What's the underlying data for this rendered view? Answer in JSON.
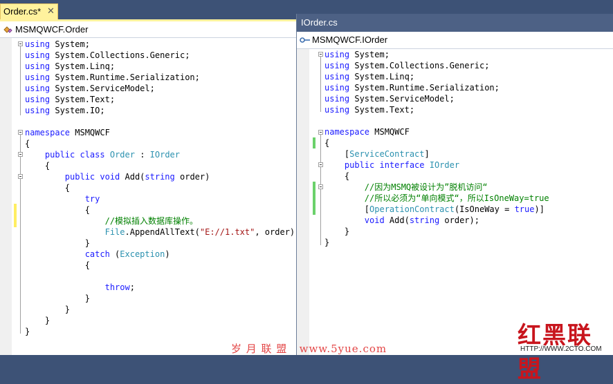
{
  "left_tab": {
    "title": "Order.cs*",
    "close_glyph": "✕"
  },
  "left_nav": {
    "label": "MSMQWCF.Order",
    "icon": "class-icon"
  },
  "right_window": {
    "title": "IOrder.cs"
  },
  "right_nav": {
    "label": "MSMQWCF.IOrder",
    "icon": "interface-icon"
  },
  "left_code": [
    [
      [
        "kw",
        "using"
      ],
      [
        "tx",
        " System;"
      ]
    ],
    [
      [
        "kw",
        "using"
      ],
      [
        "tx",
        " System.Collections.Generic;"
      ]
    ],
    [
      [
        "kw",
        "using"
      ],
      [
        "tx",
        " System.Linq;"
      ]
    ],
    [
      [
        "kw",
        "using"
      ],
      [
        "tx",
        " System.Runtime.Serialization;"
      ]
    ],
    [
      [
        "kw",
        "using"
      ],
      [
        "tx",
        " System.ServiceModel;"
      ]
    ],
    [
      [
        "kw",
        "using"
      ],
      [
        "tx",
        " System.Text;"
      ]
    ],
    [
      [
        "kw",
        "using"
      ],
      [
        "tx",
        " System.IO;"
      ]
    ],
    [],
    [
      [
        "kw",
        "namespace"
      ],
      [
        "tx",
        " MSMQWCF"
      ]
    ],
    [
      [
        "tx",
        "{"
      ]
    ],
    [
      [
        "tx",
        "    "
      ],
      [
        "kw",
        "public class"
      ],
      [
        "tx",
        " "
      ],
      [
        "ty",
        "Order"
      ],
      [
        "tx",
        " : "
      ],
      [
        "ty",
        "IOrder"
      ]
    ],
    [
      [
        "tx",
        "    {"
      ]
    ],
    [
      [
        "tx",
        "        "
      ],
      [
        "kw",
        "public void"
      ],
      [
        "tx",
        " Add("
      ],
      [
        "kw",
        "string"
      ],
      [
        "tx",
        " order)"
      ]
    ],
    [
      [
        "tx",
        "        {"
      ]
    ],
    [
      [
        "tx",
        "            "
      ],
      [
        "kw",
        "try"
      ]
    ],
    [
      [
        "tx",
        "            {"
      ]
    ],
    [
      [
        "tx",
        "                "
      ],
      [
        "cm",
        "//模拟插入数据库操作。"
      ]
    ],
    [
      [
        "tx",
        "                "
      ],
      [
        "ty",
        "File"
      ],
      [
        "tx",
        ".AppendAllText("
      ],
      [
        "str",
        "\"E://1.txt\""
      ],
      [
        "tx",
        ", order);"
      ]
    ],
    [
      [
        "tx",
        "            }"
      ]
    ],
    [
      [
        "tx",
        "            "
      ],
      [
        "kw",
        "catch"
      ],
      [
        "tx",
        " ("
      ],
      [
        "ty",
        "Exception"
      ],
      [
        "tx",
        ")"
      ]
    ],
    [
      [
        "tx",
        "            {"
      ]
    ],
    [],
    [
      [
        "tx",
        "                "
      ],
      [
        "kw",
        "throw"
      ],
      [
        "tx",
        ";"
      ]
    ],
    [
      [
        "tx",
        "            }"
      ]
    ],
    [
      [
        "tx",
        "        }"
      ]
    ],
    [
      [
        "tx",
        "    }"
      ]
    ],
    [
      [
        "tx",
        "}"
      ]
    ]
  ],
  "right_code": [
    [
      [
        "kw",
        "using"
      ],
      [
        "tx",
        " System;"
      ]
    ],
    [
      [
        "kw",
        "using"
      ],
      [
        "tx",
        " System.Collections.Generic;"
      ]
    ],
    [
      [
        "kw",
        "using"
      ],
      [
        "tx",
        " System.Linq;"
      ]
    ],
    [
      [
        "kw",
        "using"
      ],
      [
        "tx",
        " System.Runtime.Serialization;"
      ]
    ],
    [
      [
        "kw",
        "using"
      ],
      [
        "tx",
        " System.ServiceModel;"
      ]
    ],
    [
      [
        "kw",
        "using"
      ],
      [
        "tx",
        " System.Text;"
      ]
    ],
    [],
    [
      [
        "kw",
        "namespace"
      ],
      [
        "tx",
        " MSMQWCF"
      ]
    ],
    [
      [
        "tx",
        "{"
      ]
    ],
    [
      [
        "tx",
        "    ["
      ],
      [
        "ty",
        "ServiceContract"
      ],
      [
        "tx",
        "]"
      ]
    ],
    [
      [
        "tx",
        "    "
      ],
      [
        "kw",
        "public interface"
      ],
      [
        "tx",
        " "
      ],
      [
        "ty",
        "IOrder"
      ]
    ],
    [
      [
        "tx",
        "    {"
      ]
    ],
    [
      [
        "tx",
        "        "
      ],
      [
        "cm",
        "//因为MSMQ被设计为”脱机访问“"
      ]
    ],
    [
      [
        "tx",
        "        "
      ],
      [
        "cm",
        "//所以必须为“单向模式“，所以IsOneWay=true"
      ]
    ],
    [
      [
        "tx",
        "        ["
      ],
      [
        "ty",
        "OperationContract"
      ],
      [
        "tx",
        "(IsOneWay = "
      ],
      [
        "kw",
        "true"
      ],
      [
        "tx",
        ")]"
      ]
    ],
    [
      [
        "tx",
        "        "
      ],
      [
        "kw",
        "void"
      ],
      [
        "tx",
        " Add("
      ],
      [
        "kw",
        "string"
      ],
      [
        "tx",
        " order);"
      ]
    ],
    [
      [
        "tx",
        "    }"
      ]
    ],
    [
      [
        "tx",
        "}"
      ]
    ]
  ],
  "watermarks": {
    "center": "岁 月 联 盟   www.5yue.com",
    "brand": "红黑联盟",
    "brand_url": "HTTP://WWW.2CTO.COM"
  },
  "colors": {
    "keyword": "#1a1aff",
    "type": "#2b91af",
    "string": "#a31515",
    "comment": "#008000",
    "tab_active": "#fff29d",
    "chrome": "#3d5276",
    "changed_unsaved": "#ffee62",
    "changed_saved": "#6bd16b"
  }
}
